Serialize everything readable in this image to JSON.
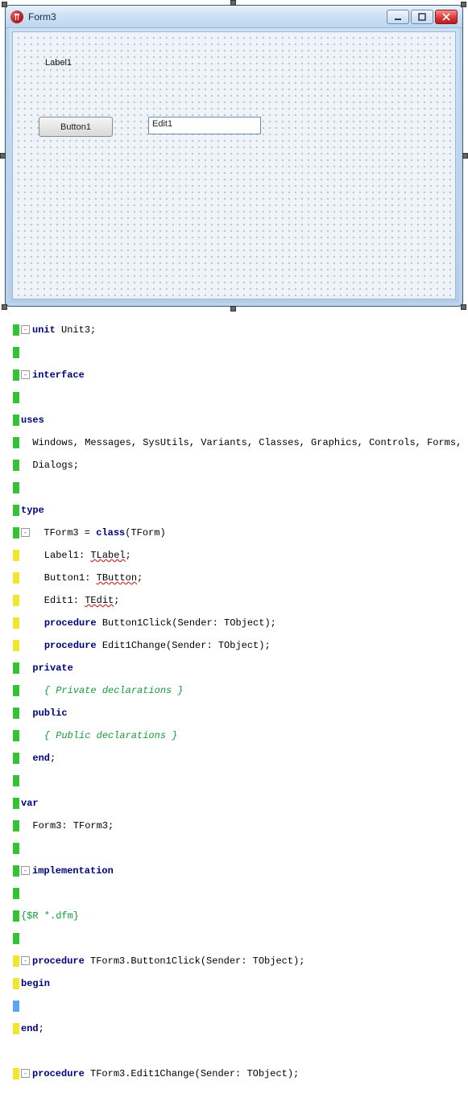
{
  "designer": {
    "title": "Form3",
    "label1_caption": "Label1",
    "button1_caption": "Button1",
    "edit1_text": "Edit1"
  },
  "code": {
    "unit_kw": "unit",
    "unit_name": "Unit3;",
    "interface_kw": "interface",
    "uses_kw": "uses",
    "uses_list": "  Windows, Messages, SysUtils, Variants, Classes, Graphics, Controls, Forms,",
    "uses_list2": "  Dialogs;",
    "type_kw": "type",
    "class_decl_pre": "  TForm3 = ",
    "class_kw": "class",
    "class_decl_post": "(TForm)",
    "label1_field": "    Label1: ",
    "label1_type": "TLabel",
    "button1_field": "    Button1: ",
    "button1_type": "TButton",
    "edit1_field": "    Edit1: ",
    "edit1_type": "TEdit",
    "proc_kw": "procedure",
    "proc1": "    ",
    "proc1_sig": " Button1Click(Sender: TObject);",
    "proc2": "    ",
    "proc2_sig": " Edit1Change(Sender: TObject);",
    "private_kw": "private",
    "private_line": "  ",
    "private_comment": "    { Private declarations }",
    "public_kw": "public",
    "public_line": "  ",
    "public_comment": "    { Public declarations }",
    "end_kw": "end",
    "end_line": "  ",
    "end_semi": ";",
    "var_kw": "var",
    "var_line": "  Form3: TForm3;",
    "impl_kw": "implementation",
    "directive": "{$R *.dfm}",
    "p1_header_kw": "procedure",
    "p1_header": " TForm3.Button1Click(Sender: TObject);",
    "begin_kw": "begin",
    "end2_kw": "end",
    "p2_header_kw": "procedure",
    "p2_header": " TForm3.Edit1Change(Sender: TObject);"
  }
}
